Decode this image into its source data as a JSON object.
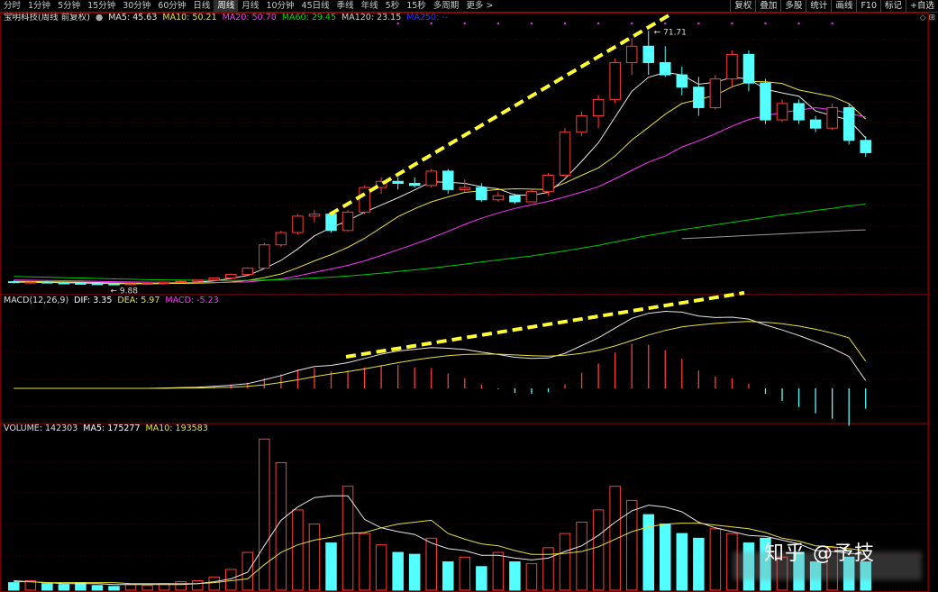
{
  "toolbar": {
    "timeframes": [
      "分时",
      "1分钟",
      "5分钟",
      "15分钟",
      "30分钟",
      "60分钟",
      "日线",
      "周线",
      "月线",
      "10分钟",
      "45日线",
      "季线",
      "年线",
      "5秒",
      "15秒",
      "多周期",
      "更多 >"
    ],
    "active_index": 7,
    "right_buttons": [
      "复权",
      "叠加",
      "多股",
      "统计",
      "画线",
      "F10",
      "标记",
      "+自选"
    ]
  },
  "price_panel": {
    "stock_name": "宝明科技(周线 前复权)",
    "ma5": "MA5: 45.63",
    "ma10": "MA10: 50.21",
    "ma20": "MA20: 50.70",
    "ma60": "MA60: 29.45",
    "ma120": "MA120: 23.15",
    "ma_extra": "MA250: --",
    "high_label": "71.71",
    "low_label": "9.88"
  },
  "macd_panel": {
    "name": "MACD(12,26,9)",
    "dif": "DIF: 3.35",
    "dea": "DEA: 5.97",
    "macd": "MACD: -5.23"
  },
  "volume_panel": {
    "name": "VOLUME: 142303",
    "ma5": "MA5: 175277",
    "ma10": "MA10: 193583"
  },
  "watermark": "知乎 @予技",
  "colors": {
    "up": "#ff3b3b",
    "down": "#54ffff",
    "ma5": "#e6e6e6",
    "ma10": "#e8e03a",
    "ma20": "#ff33ff",
    "ma60": "#00cc00",
    "ma120": "#9a9a9a",
    "trend": "#ffff33",
    "grid": "#7a0000"
  },
  "chart_data": {
    "type": "candlestick",
    "ohlc": [
      [
        10.5,
        10.8,
        10.1,
        10.3
      ],
      [
        10.3,
        10.6,
        10.0,
        10.4
      ],
      [
        10.4,
        10.7,
        10.1,
        10.2
      ],
      [
        10.2,
        10.5,
        9.9,
        10.1
      ],
      [
        10.1,
        10.4,
        9.9,
        10.0
      ],
      [
        10.0,
        10.3,
        9.9,
        9.95
      ],
      [
        9.95,
        10.1,
        9.88,
        9.9
      ],
      [
        9.9,
        10.2,
        9.88,
        10.0
      ],
      [
        10.0,
        10.3,
        9.9,
        10.1
      ],
      [
        10.1,
        10.5,
        10.0,
        10.4
      ],
      [
        10.4,
        10.8,
        10.2,
        10.6
      ],
      [
        10.6,
        11.0,
        10.4,
        10.9
      ],
      [
        10.9,
        11.5,
        10.8,
        11.4
      ],
      [
        11.4,
        12.5,
        11.3,
        12.3
      ],
      [
        12.3,
        14.0,
        12.2,
        13.8
      ],
      [
        13.8,
        20.0,
        13.6,
        19.5
      ],
      [
        19.5,
        23.0,
        19.0,
        22.5
      ],
      [
        22.5,
        27.0,
        22.0,
        26.5
      ],
      [
        26.5,
        28.0,
        25.0,
        27.0
      ],
      [
        27.0,
        27.5,
        22.5,
        23.0
      ],
      [
        23.0,
        28.0,
        22.8,
        27.5
      ],
      [
        27.5,
        34.0,
        27.0,
        33.5
      ],
      [
        33.5,
        36.0,
        32.0,
        35.0
      ],
      [
        35.0,
        36.0,
        33.0,
        34.5
      ],
      [
        34.5,
        36.0,
        33.5,
        34.0
      ],
      [
        34.0,
        38.0,
        33.5,
        37.5
      ],
      [
        37.5,
        38.0,
        32.0,
        33.0
      ],
      [
        33.0,
        35.5,
        32.5,
        33.5
      ],
      [
        33.5,
        34.5,
        30.0,
        30.5
      ],
      [
        30.5,
        32.5,
        30.0,
        31.5
      ],
      [
        31.5,
        32.0,
        29.5,
        30.0
      ],
      [
        30.0,
        33.0,
        30.0,
        32.5
      ],
      [
        32.5,
        37.0,
        31.5,
        36.5
      ],
      [
        36.5,
        48.0,
        36.0,
        47.0
      ],
      [
        47.0,
        52.0,
        46.0,
        51.0
      ],
      [
        51.0,
        56.0,
        48.0,
        55.0
      ],
      [
        55.0,
        65.0,
        54.0,
        64.0
      ],
      [
        64.0,
        70.0,
        61.0,
        68.0
      ],
      [
        68.0,
        71.71,
        61.0,
        64.0
      ],
      [
        64.0,
        68.0,
        60.5,
        61.0
      ],
      [
        61.0,
        63.0,
        56.0,
        58.0
      ],
      [
        58.0,
        60.5,
        51.0,
        53.0
      ],
      [
        53.0,
        61.0,
        52.5,
        60.0
      ],
      [
        60.0,
        67.0,
        58.0,
        66.0
      ],
      [
        66.0,
        67.0,
        57.0,
        59.0
      ],
      [
        59.0,
        60.0,
        49.0,
        50.0
      ],
      [
        50.0,
        55.0,
        49.5,
        54.0
      ],
      [
        54.0,
        55.0,
        49.0,
        50.0
      ],
      [
        50.0,
        51.0,
        47.0,
        48.0
      ],
      [
        48.0,
        54.0,
        47.5,
        53.0
      ],
      [
        53.0,
        54.0,
        44.0,
        45.0
      ],
      [
        45.0,
        46.0,
        41.0,
        42.0
      ]
    ],
    "ma_series": [
      {
        "name": "MA5",
        "values": [
          10.4,
          10.35,
          10.3,
          10.25,
          10.2,
          10.1,
          10.05,
          10.0,
          10.0,
          10.05,
          10.2,
          10.4,
          10.7,
          11.3,
          12.0,
          13.7,
          15.7,
          18.5,
          21.7,
          23.7,
          25.4,
          27.5,
          29.2,
          31.0,
          32.9,
          34.9,
          34.8,
          34.5,
          33.7,
          33.2,
          31.7,
          31.6,
          32.3,
          35.6,
          39.9,
          44.4,
          50.7,
          57.0,
          60.4,
          61.6,
          61.0,
          58.7,
          59.2,
          60.4,
          60.0,
          57.5,
          56.6,
          55.8,
          52.2,
          51.0,
          50.0,
          45.63
        ]
      },
      {
        "name": "MA10",
        "values": [
          10.6,
          10.55,
          10.5,
          10.45,
          10.4,
          10.3,
          10.2,
          10.15,
          10.1,
          10.1,
          10.1,
          10.15,
          10.25,
          10.45,
          10.8,
          11.5,
          12.4,
          13.9,
          15.6,
          17.1,
          18.9,
          21.1,
          23.7,
          26.4,
          28.3,
          30.0,
          31.2,
          32.3,
          32.7,
          33.0,
          33.2,
          33.1,
          33.0,
          34.6,
          36.5,
          38.3,
          41.2,
          45.1,
          48.2,
          51.4,
          54.0,
          55.0,
          56.0,
          58.1,
          59.4,
          59.3,
          58.9,
          57.3,
          56.5,
          55.7,
          54.0,
          50.21
        ]
      },
      {
        "name": "MA20",
        "values": [
          10.9,
          10.85,
          10.8,
          10.75,
          10.7,
          10.6,
          10.5,
          10.45,
          10.4,
          10.35,
          10.3,
          10.3,
          10.3,
          10.35,
          10.45,
          10.8,
          11.2,
          11.9,
          12.8,
          13.6,
          14.5,
          15.6,
          16.9,
          18.3,
          19.7,
          21.2,
          22.8,
          24.5,
          26.0,
          27.3,
          28.4,
          29.3,
          30.1,
          31.2,
          32.4,
          33.7,
          35.6,
          37.7,
          39.7,
          41.2,
          43.4,
          44.9,
          46.6,
          48.5,
          50.1,
          51.0,
          51.8,
          52.4,
          53.0,
          52.5,
          51.6,
          50.7
        ]
      },
      {
        "name": "MA60",
        "values": [
          11.8,
          11.7,
          11.6,
          11.5,
          11.4,
          11.3,
          11.2,
          11.1,
          11.0,
          10.95,
          10.9,
          10.85,
          10.8,
          10.8,
          10.8,
          10.9,
          11.0,
          11.2,
          11.4,
          11.6,
          11.9,
          12.2,
          12.6,
          13.0,
          13.4,
          13.8,
          14.3,
          14.8,
          15.3,
          15.8,
          16.3,
          16.8,
          17.4,
          18.0,
          18.7,
          19.4,
          20.2,
          21.0,
          21.8,
          22.5,
          23.2,
          23.8,
          24.4,
          25.0,
          25.6,
          26.2,
          26.8,
          27.3,
          27.9,
          28.4,
          29.0,
          29.45
        ]
      },
      {
        "name": "MA120",
        "values": [
          null,
          null,
          null,
          null,
          null,
          null,
          null,
          null,
          null,
          null,
          null,
          null,
          null,
          null,
          null,
          null,
          null,
          null,
          null,
          null,
          null,
          null,
          null,
          null,
          null,
          null,
          null,
          null,
          null,
          null,
          null,
          null,
          null,
          null,
          null,
          null,
          null,
          null,
          null,
          null,
          21.0,
          21.2,
          21.4,
          21.6,
          21.8,
          22.0,
          22.2,
          22.4,
          22.6,
          22.8,
          23.0,
          23.15
        ]
      }
    ],
    "macd": {
      "dif": [
        0,
        0,
        0,
        0,
        0,
        0,
        0,
        0,
        0,
        0.1,
        0.2,
        0.3,
        0.5,
        0.8,
        1.2,
        2.2,
        3.3,
        4.6,
        5.6,
        5.9,
        6.6,
        7.7,
        8.8,
        9.6,
        10.0,
        10.5,
        10.3,
        10.0,
        9.3,
        8.7,
        8.0,
        7.7,
        7.8,
        9.0,
        11.0,
        13.0,
        15.5,
        18.0,
        19.3,
        19.8,
        19.6,
        18.6,
        18.2,
        18.3,
        17.8,
        16.3,
        15.0,
        13.6,
        12.0,
        10.3,
        8.2,
        3.35
      ],
      "dea": [
        0,
        0,
        0,
        0,
        0,
        0,
        0,
        0,
        0,
        0.0,
        0.1,
        0.1,
        0.2,
        0.3,
        0.5,
        0.9,
        1.5,
        2.2,
        3.0,
        3.7,
        4.3,
        5.0,
        5.8,
        6.6,
        7.3,
        7.9,
        8.4,
        8.7,
        8.8,
        8.8,
        8.6,
        8.4,
        8.3,
        8.5,
        9.0,
        9.8,
        10.9,
        12.3,
        13.7,
        14.9,
        15.8,
        16.3,
        16.7,
        17.0,
        17.2,
        17.0,
        16.6,
        16.0,
        15.2,
        14.2,
        13.0,
        5.97
      ],
      "hist": [
        0,
        0,
        0,
        0,
        0,
        0,
        0,
        0,
        0,
        0.2,
        0.2,
        0.4,
        0.6,
        1.0,
        1.4,
        2.6,
        3.6,
        4.8,
        5.2,
        4.4,
        4.6,
        5.4,
        6.0,
        6.0,
        5.4,
        5.2,
        3.8,
        2.6,
        1.0,
        -0.2,
        -1.2,
        -1.4,
        -1.0,
        1.0,
        4.0,
        6.4,
        9.2,
        11.4,
        11.2,
        9.8,
        7.6,
        4.6,
        3.0,
        2.6,
        1.2,
        -1.4,
        -3.2,
        -4.8,
        -6.4,
        -7.8,
        -9.6,
        -5.23
      ]
    },
    "volume": {
      "values": [
        8,
        10,
        7,
        6,
        8,
        5,
        4,
        6,
        5,
        7,
        9,
        10,
        14,
        22,
        40,
        160,
        135,
        85,
        70,
        50,
        110,
        60,
        48,
        40,
        38,
        55,
        30,
        35,
        25,
        40,
        30,
        28,
        45,
        60,
        72,
        85,
        110,
        95,
        80,
        70,
        60,
        55,
        65,
        60,
        50,
        55,
        35,
        40,
        30,
        45,
        35,
        30
      ],
      "ma5": [
        10,
        9,
        8,
        7,
        7,
        7,
        6,
        6,
        6,
        6,
        6,
        7,
        9,
        12,
        19,
        47,
        74,
        88,
        98,
        100,
        100,
        75,
        66,
        62,
        59,
        50,
        44,
        42,
        37,
        37,
        34,
        32,
        34,
        41,
        47,
        58,
        72,
        84,
        90,
        88,
        83,
        72,
        66,
        62,
        58,
        57,
        53,
        49,
        42,
        41,
        39,
        175277
      ],
      "ma10": [
        9,
        9,
        8,
        8,
        8,
        8,
        8,
        7,
        7,
        7,
        7,
        7,
        8,
        10,
        12,
        27,
        40,
        48,
        53,
        56,
        60,
        61,
        66,
        70,
        72,
        74,
        60,
        54,
        49,
        47,
        42,
        38,
        38,
        39,
        41,
        46,
        54,
        62,
        67,
        70,
        71,
        71,
        69,
        67,
        65,
        61,
        55,
        52,
        47,
        46,
        44,
        193583
      ]
    }
  }
}
